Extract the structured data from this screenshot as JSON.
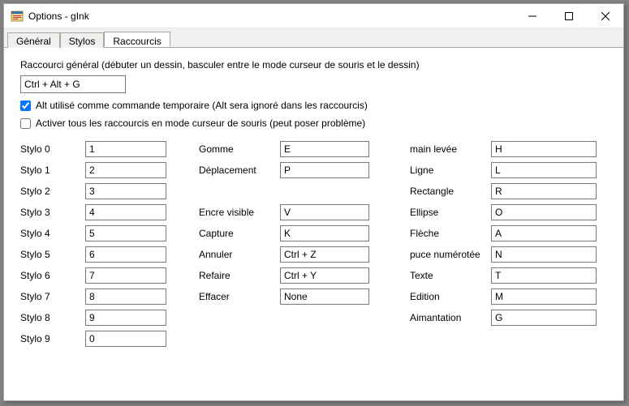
{
  "window": {
    "title": "Options - gInk"
  },
  "tabs": {
    "general": "Général",
    "pens": "Stylos",
    "hotkeys": "Raccourcis"
  },
  "desc": {
    "general": "Raccourci général (débuter un dessin, basculer entre le mode curseur de souris et le dessin)",
    "general_value": "Ctrl + Alt + G",
    "alt_temp": "Alt utilisé comme commande temporaire (Alt sera ignoré dans les raccourcis)",
    "enable_all": "Activer tous les raccourcis en mode curseur de souris (peut poser problème)"
  },
  "left": [
    {
      "label": "Stylo 0",
      "value": "1"
    },
    {
      "label": "Stylo 1",
      "value": "2"
    },
    {
      "label": "Stylo 2",
      "value": "3"
    },
    {
      "label": "Stylo 3",
      "value": "4"
    },
    {
      "label": "Stylo 4",
      "value": "5"
    },
    {
      "label": "Stylo 5",
      "value": "6"
    },
    {
      "label": "Stylo 6",
      "value": "7"
    },
    {
      "label": "Stylo 7",
      "value": "8"
    },
    {
      "label": "Stylo 8",
      "value": "9"
    },
    {
      "label": "Stylo 9",
      "value": "0"
    }
  ],
  "mid_a": [
    {
      "label": "Gomme",
      "value": "E"
    },
    {
      "label": "Déplacement",
      "value": "P"
    }
  ],
  "mid_b": [
    {
      "label": "Encre visible",
      "value": "V"
    },
    {
      "label": "Capture",
      "value": "K"
    },
    {
      "label": "Annuler",
      "value": "Ctrl + Z"
    },
    {
      "label": "Refaire",
      "value": "Ctrl + Y"
    },
    {
      "label": "Effacer",
      "value": "None"
    }
  ],
  "right": [
    {
      "label": "main levée",
      "value": "H"
    },
    {
      "label": "Ligne",
      "value": "L"
    },
    {
      "label": "Rectangle",
      "value": "R"
    },
    {
      "label": "Ellipse",
      "value": "O"
    },
    {
      "label": "Flèche",
      "value": "A"
    },
    {
      "label": "puce numérotée",
      "value": "N"
    },
    {
      "label": "Texte",
      "value": "T"
    },
    {
      "label": "Edition",
      "value": "M"
    },
    {
      "label": "Aimantation",
      "value": "G"
    }
  ]
}
